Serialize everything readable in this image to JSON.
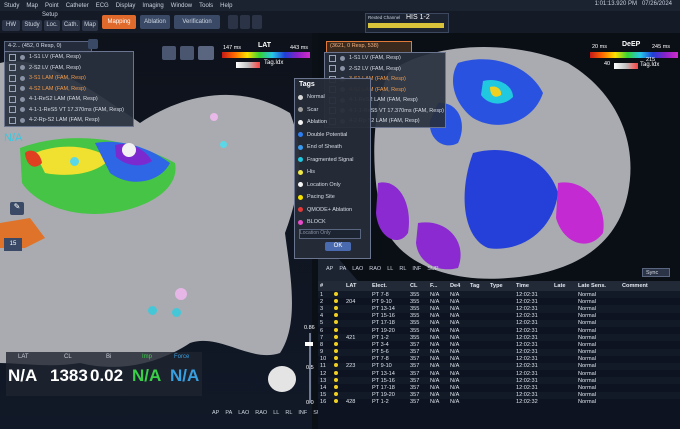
{
  "menu": [
    "Study",
    "Map",
    "Point",
    "Catheter",
    "ECG",
    "Display",
    "Imaging",
    "Window",
    "Tools",
    "Help"
  ],
  "clock": "1:01:13.920 PM",
  "date": "07/26/2024",
  "setup_label": "Setup",
  "toolbar": {
    "hw": "HW",
    "study": "Study",
    "loc": "Loc.",
    "cath": "Cath.",
    "map": "Map",
    "mapping": "Mapping",
    "ablation": "Ablation",
    "verification": "Verification"
  },
  "ref_channel": {
    "label": "Rexted Channel",
    "value": "HIS 1-2"
  },
  "left_map": {
    "dropdown": "4-2... (452, 0 Resp, 0)",
    "lat_min": "147 ms",
    "lat_label": "LAT",
    "lat_max": "443 ms",
    "tag_label": "Tag.Idx",
    "na_label": "N/A",
    "list": [
      {
        "label": "1-S1 LV (FAM, Resp)",
        "highlight": false
      },
      {
        "label": "2-S2 LV (FAM, Resp)",
        "highlight": false
      },
      {
        "label": "3-S1 LAM (FAM, Resp)",
        "highlight": true
      },
      {
        "label": "4-S2 LAM (FAM, Resp)",
        "highlight": true
      },
      {
        "label": "4-1-ReS2 LAM (FAM, Resp)",
        "highlight": false
      },
      {
        "label": "4-1-1-ReS5 VT 17.370ms (FAM, Resp)",
        "highlight": false
      },
      {
        "label": "4-2-Rp-S2 LAM (FAM, Resp)",
        "highlight": false
      }
    ],
    "side_num": "15",
    "scale_values": [
      "0.86",
      "0.5",
      "0.0"
    ]
  },
  "right_map": {
    "dropdown": "(3621, 0 Resp, 538)",
    "detp_min": "20 ms",
    "detp_label": "DeEP",
    "detp_max": "245 ms",
    "tag_label": "Tag.Idx",
    "tag_min": "40",
    "tag_max": "215",
    "list": [
      {
        "label": "1-S1 LV (FAM, Resp)",
        "highlight": false
      },
      {
        "label": "2-S2 LV (FAM, Resp)",
        "highlight": false
      },
      {
        "label": "3-S1 LAM (FAM, Resp)",
        "highlight": true
      },
      {
        "label": "4-S2 LAM (FAM, Resp)",
        "highlight": true
      },
      {
        "label": "4-1-ReS2 LAM (FAM, Resp)",
        "highlight": false
      },
      {
        "label": "4-1-1-ReS5 VT 17.370ms (FAM, Resp)",
        "highlight": false
      },
      {
        "label": "4-2-Rp-S2 LAM (FAM, Resp)",
        "highlight": false
      }
    ],
    "sync": "Sync"
  },
  "tags": {
    "title": "Tags",
    "items": [
      {
        "label": "Normal",
        "color": "#d8d8d8"
      },
      {
        "label": "Scar",
        "color": "#a0a0a0"
      },
      {
        "label": "Ablation",
        "color": "#f2f2f2"
      },
      {
        "label": "Double Potential",
        "color": "#2e7df0"
      },
      {
        "label": "End of Sheath",
        "color": "#3a9af0"
      },
      {
        "label": "Fragmented Signal",
        "color": "#20c8e0"
      },
      {
        "label": "His",
        "color": "#f0e84a"
      },
      {
        "label": "Location Only",
        "color": "#f6f6f6"
      },
      {
        "label": "Pacing Site",
        "color": "#f5e200"
      },
      {
        "label": "QMODE+ Ablation",
        "color": "#e23a3a"
      },
      {
        "label": "BLOCK",
        "color": "#e64cc8"
      }
    ],
    "select_placeholder": "Location Only",
    "ok": "OK"
  },
  "view_buttons": [
    "AP",
    "PA",
    "LAO",
    "RAO",
    "LL",
    "RL",
    "INF",
    "SUP"
  ],
  "readout": {
    "lat_label": "LAT",
    "lat_value": "N/A",
    "cl_label": "CL",
    "cl_value": "1383",
    "bi_label": "Bi",
    "bi_value": "0.02",
    "imp_label": "Imp",
    "imp_value": "N/A",
    "force_label": "Force",
    "force_value": "N/A"
  },
  "table": {
    "columns": [
      "#",
      "",
      "LAT",
      "Elect.",
      "CL",
      "F...",
      "De4",
      "Tag",
      "Type",
      "Time",
      "Late",
      "Late Sens.",
      "Comment"
    ],
    "rows": [
      [
        "1",
        "",
        "",
        "PT 7-8",
        "355",
        "N/A",
        "N/A",
        "",
        "",
        "12:02:31",
        "",
        "Normal",
        ""
      ],
      [
        "2",
        "",
        "204",
        "PT 9-10",
        "355",
        "N/A",
        "N/A",
        "",
        "",
        "12:02:31",
        "",
        "Normal",
        ""
      ],
      [
        "3",
        "",
        "",
        "PT 13-14",
        "355",
        "N/A",
        "N/A",
        "",
        "",
        "12:02:31",
        "",
        "Normal",
        ""
      ],
      [
        "4",
        "",
        "",
        "PT 15-16",
        "355",
        "N/A",
        "N/A",
        "",
        "",
        "12:02:31",
        "",
        "Normal",
        ""
      ],
      [
        "5",
        "",
        "",
        "PT 17-18",
        "355",
        "N/A",
        "N/A",
        "",
        "",
        "12:02:31",
        "",
        "Normal",
        ""
      ],
      [
        "6",
        "",
        "",
        "PT 19-20",
        "355",
        "N/A",
        "N/A",
        "",
        "",
        "12:02:31",
        "",
        "Normal",
        ""
      ],
      [
        "7",
        "",
        "421",
        "PT 1-2",
        "355",
        "N/A",
        "N/A",
        "",
        "",
        "12:02:31",
        "",
        "Normal",
        ""
      ],
      [
        "8",
        "",
        "",
        "PT 3-4",
        "357",
        "N/A",
        "N/A",
        "",
        "",
        "12:02:31",
        "",
        "Normal",
        ""
      ],
      [
        "9",
        "",
        "",
        "PT 5-6",
        "357",
        "N/A",
        "N/A",
        "",
        "",
        "12:02:31",
        "",
        "Normal",
        ""
      ],
      [
        "10",
        "",
        "",
        "PT 7-8",
        "357",
        "N/A",
        "N/A",
        "",
        "",
        "12:02:31",
        "",
        "Normal",
        ""
      ],
      [
        "11",
        "",
        "223",
        "PT 9-10",
        "357",
        "N/A",
        "N/A",
        "",
        "",
        "12:02:31",
        "",
        "Normal",
        ""
      ],
      [
        "12",
        "",
        "",
        "PT 13-14",
        "357",
        "N/A",
        "N/A",
        "",
        "",
        "12:02:31",
        "",
        "Normal",
        ""
      ],
      [
        "13",
        "",
        "",
        "PT 15-16",
        "357",
        "N/A",
        "N/A",
        "",
        "",
        "12:02:31",
        "",
        "Normal",
        ""
      ],
      [
        "14",
        "",
        "",
        "PT 17-18",
        "357",
        "N/A",
        "N/A",
        "",
        "",
        "12:02:31",
        "",
        "Normal",
        ""
      ],
      [
        "15",
        "",
        "",
        "PT 19-20",
        "357",
        "N/A",
        "N/A",
        "",
        "",
        "12:02:31",
        "",
        "Normal",
        ""
      ],
      [
        "16",
        "",
        "428",
        "PT 1-2",
        "357",
        "N/A",
        "N/A",
        "",
        "",
        "12:02:32",
        "",
        "Normal",
        ""
      ]
    ]
  },
  "colors": {
    "accent": "#e06a2c",
    "panel": "#242c3c",
    "anatomy": "#a9abb0"
  }
}
